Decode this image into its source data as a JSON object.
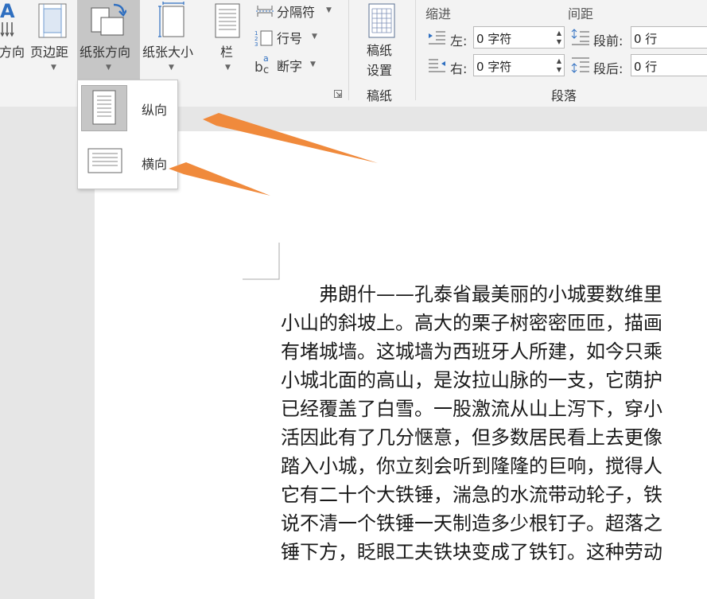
{
  "ribbon": {
    "orientation_text_label": "方向",
    "margins_label": "页边距",
    "page_orientation_label": "纸张方向",
    "page_size_label": "纸张大小",
    "columns_label": "栏",
    "breaks_label": "分隔符",
    "line_numbers_label": "行号",
    "hyphenation_label": "断字",
    "manuscript": {
      "button_line1": "稿纸",
      "button_line2": "设置",
      "group_label": "稿纸"
    },
    "paragraph": {
      "indent_header": "缩进",
      "spacing_header": "间距",
      "left_label": "左:",
      "right_label": "右:",
      "before_label": "段前:",
      "after_label": "段后:",
      "left_value": "0 字符",
      "right_value": "0 字符",
      "before_value": "0 行",
      "after_value": "0 行",
      "group_label": "段落"
    }
  },
  "orientation_menu": {
    "portrait_label": "纵向",
    "landscape_label": "横向"
  },
  "document": {
    "lines": [
      "　　弗朗什——孔泰省最美丽的小城要数维里",
      "小山的斜坡上。高大的栗子树密密匝匝，描画",
      "有堵城墙。这城墙为西班牙人所建，如今只乘",
      "小城北面的高山，是汝拉山脉的一支，它荫护",
      "已经覆盖了白雪。一股激流从山上泻下，穿小",
      "活因此有了几分惬意，但多数居民看上去更像",
      "踏入小城，你立刻会听到隆隆的巨响，搅得人",
      "它有二十个大铁锤，湍急的水流带动轮子，铁",
      "说不清一个铁锤一天制造多少根钉子。超落之",
      "锤下方，眨眼工夫铁块变成了铁钉。这种劳动"
    ]
  },
  "colors": {
    "arrow": "#f08a3c",
    "selected": "#c6c6c6",
    "accent_blue": "#2f6fc0"
  }
}
